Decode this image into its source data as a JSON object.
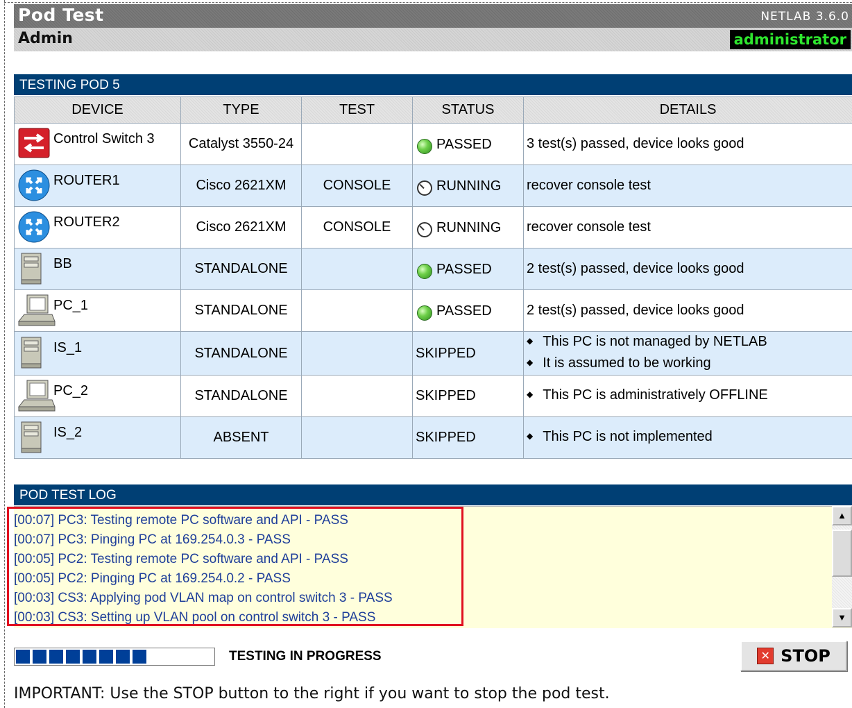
{
  "header": {
    "title": "Pod Test",
    "subtitle": "Admin",
    "version": "NETLAB 3.6.0",
    "user_role": "administrator"
  },
  "pod_table": {
    "section_title": "TESTING POD 5",
    "columns": [
      "DEVICE",
      "TYPE",
      "TEST",
      "STATUS",
      "DETAILS"
    ],
    "rows": [
      {
        "icon": "switch-icon",
        "device": "Control Switch 3",
        "type": "Catalyst 3550-24",
        "test": "",
        "status": "PASSED",
        "details": [
          "3 test(s) passed, device looks good"
        ]
      },
      {
        "icon": "router-icon",
        "device": "ROUTER1",
        "type": "Cisco 2621XM",
        "test": "CONSOLE",
        "status": "RUNNING",
        "details": [
          "recover console test"
        ]
      },
      {
        "icon": "router-icon",
        "device": "ROUTER2",
        "type": "Cisco 2621XM",
        "test": "CONSOLE",
        "status": "RUNNING",
        "details": [
          "recover console test"
        ]
      },
      {
        "icon": "server-icon",
        "device": "BB",
        "type": "STANDALONE",
        "test": "",
        "status": "PASSED",
        "details": [
          "2 test(s) passed, device looks good"
        ]
      },
      {
        "icon": "pc-icon",
        "device": "PC_1",
        "type": "STANDALONE",
        "test": "",
        "status": "PASSED",
        "details": [
          "2 test(s) passed, device looks good"
        ]
      },
      {
        "icon": "server-icon",
        "device": "IS_1",
        "type": "STANDALONE",
        "test": "",
        "status": "SKIPPED",
        "details": [
          "This PC is not managed by NETLAB",
          "It is assumed to be working"
        ]
      },
      {
        "icon": "pc-icon",
        "device": "PC_2",
        "type": "STANDALONE",
        "test": "",
        "status": "SKIPPED",
        "details": [
          "This PC is administratively OFFLINE"
        ]
      },
      {
        "icon": "server-icon",
        "device": "IS_2",
        "type": "ABSENT",
        "test": "",
        "status": "SKIPPED",
        "details": [
          "This PC is not implemented"
        ]
      }
    ]
  },
  "log": {
    "section_title": "POD TEST LOG",
    "lines": [
      "[00:07] PC3: Testing remote PC software and API - PASS",
      "[00:07] PC3: Pinging PC at 169.254.0.3 - PASS",
      "[00:05] PC2: Testing remote PC software and API - PASS",
      "[00:05] PC2: Pinging PC at 169.254.0.2 - PASS",
      "[00:03] CS3: Applying pod VLAN map on control switch 3 - PASS",
      "[00:03] CS3: Setting up VLAN pool on control switch 3 - PASS"
    ]
  },
  "progress": {
    "status_text": "TESTING IN PROGRESS",
    "filled_blocks": 8,
    "total_blocks": 12
  },
  "stop_button": {
    "label": "STOP"
  },
  "note": "IMPORTANT: Use the STOP button to the right if you want to stop the pod test.",
  "colors": {
    "header_bar": "#003f74",
    "alt_row": "#dcecfb",
    "log_bg": "#ffffdc",
    "log_text": "#1f3f9a",
    "user_badge_text": "#2ee62e",
    "highlight_border": "#e01020",
    "progress_fill": "#003f98"
  }
}
